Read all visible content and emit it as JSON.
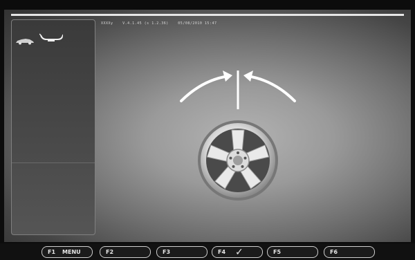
{
  "status": {
    "model": "XXXXy",
    "version": "V.4.1.45 (s 1.2.36)",
    "datetime": "05/08/2010  15:47"
  },
  "icons": {
    "car": "car-icon",
    "weight": "clip-weight-icon",
    "arrow_left": "curved-arrow-right-icon",
    "arrow_right": "curved-arrow-left-icon",
    "wheel": "alloy-wheel-icon",
    "check": "check-icon"
  },
  "fkeys": [
    {
      "key": "F1",
      "label": "MENU"
    },
    {
      "key": "F2",
      "label": ""
    },
    {
      "key": "F3",
      "label": ""
    },
    {
      "key": "F4",
      "label": "✓"
    },
    {
      "key": "F5",
      "label": ""
    },
    {
      "key": "F6",
      "label": ""
    }
  ],
  "colors": {
    "background": "#9a9a9a",
    "foreground": "#ffffff",
    "panel": "#444444"
  }
}
